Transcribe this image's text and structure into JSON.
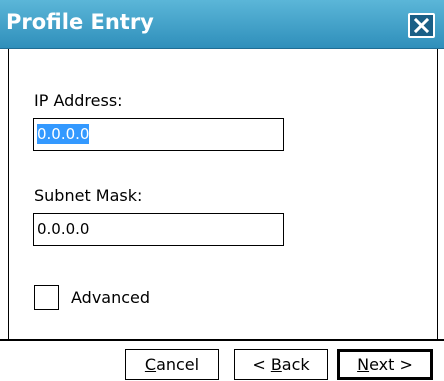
{
  "window": {
    "title": "Profile Entry",
    "close_label": "X"
  },
  "form": {
    "ip_label": "IP Address:",
    "ip_value": "0.0.0.0",
    "subnet_label": "Subnet Mask:",
    "subnet_value": "0.0.0.0",
    "advanced_label": "Advanced",
    "advanced_checked": false
  },
  "buttons": {
    "cancel_prefix": "",
    "cancel_u": "C",
    "cancel_rest": "ancel",
    "back_prefix": "< ",
    "back_u": "B",
    "back_rest": "ack",
    "next_prefix": "",
    "next_u": "N",
    "next_rest": "ext >"
  },
  "colors": {
    "title_bar": "#2f8fbb",
    "selection": "#3399ff"
  }
}
